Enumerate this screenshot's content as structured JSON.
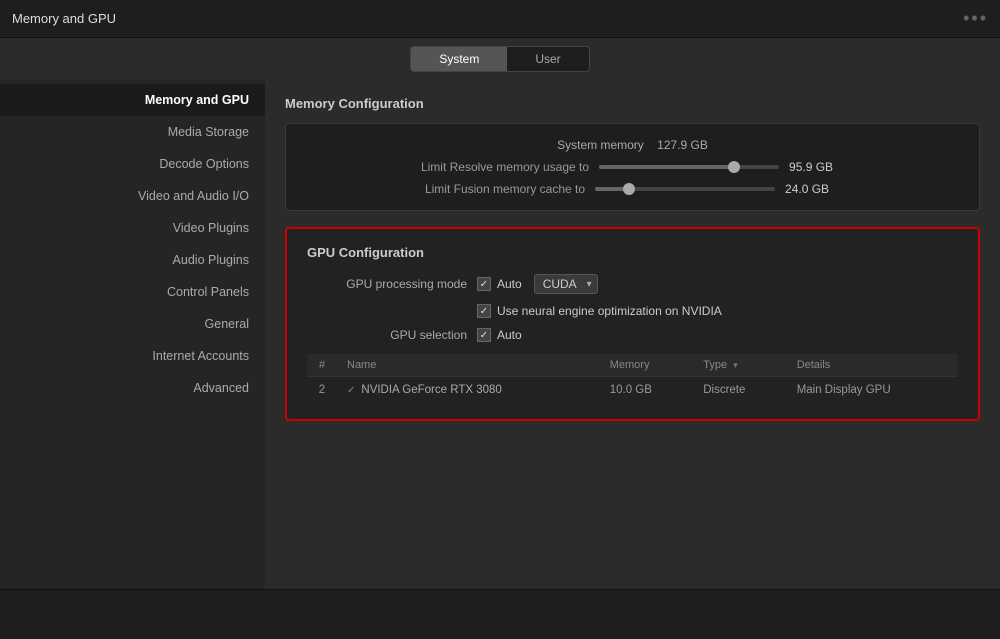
{
  "window": {
    "title": "Memory and GPU",
    "dots": "•••"
  },
  "tabs": {
    "system": "System",
    "user": "User",
    "active": "system"
  },
  "sidebar": {
    "items": [
      {
        "id": "memory-gpu",
        "label": "Memory and GPU",
        "active": true
      },
      {
        "id": "media-storage",
        "label": "Media Storage",
        "active": false
      },
      {
        "id": "decode-options",
        "label": "Decode Options",
        "active": false
      },
      {
        "id": "video-audio-io",
        "label": "Video and Audio I/O",
        "active": false
      },
      {
        "id": "video-plugins",
        "label": "Video Plugins",
        "active": false
      },
      {
        "id": "audio-plugins",
        "label": "Audio Plugins",
        "active": false
      },
      {
        "id": "control-panels",
        "label": "Control Panels",
        "active": false
      },
      {
        "id": "general",
        "label": "General",
        "active": false
      },
      {
        "id": "internet-accounts",
        "label": "Internet Accounts",
        "active": false
      },
      {
        "id": "advanced",
        "label": "Advanced",
        "active": false
      }
    ]
  },
  "main": {
    "memory_section": {
      "title": "Memory Configuration",
      "system_memory_label": "System memory",
      "system_memory_value": "127.9 GB",
      "limit_resolve_label": "Limit Resolve memory usage to",
      "limit_resolve_value": "95.9 GB",
      "limit_resolve_percent": 75,
      "limit_fusion_label": "Limit Fusion memory cache to",
      "limit_fusion_value": "24.0 GB",
      "limit_fusion_percent": 19
    },
    "gpu_section": {
      "title": "GPU Configuration",
      "processing_mode_label": "GPU processing mode",
      "processing_mode_checked": true,
      "processing_mode_value": "Auto",
      "processing_mode_dropdown": "CUDA",
      "neural_engine_checked": true,
      "neural_engine_label": "Use neural engine optimization on NVIDIA",
      "gpu_selection_label": "GPU selection",
      "gpu_selection_checked": true,
      "gpu_selection_value": "Auto",
      "table": {
        "columns": [
          "#",
          "Name",
          "Memory",
          "Type",
          "Details"
        ],
        "rows": [
          {
            "num": "2",
            "checked": true,
            "name": "NVIDIA GeForce RTX 3080",
            "memory": "10.0 GB",
            "type": "Discrete",
            "details": "Main Display GPU"
          }
        ]
      }
    }
  }
}
